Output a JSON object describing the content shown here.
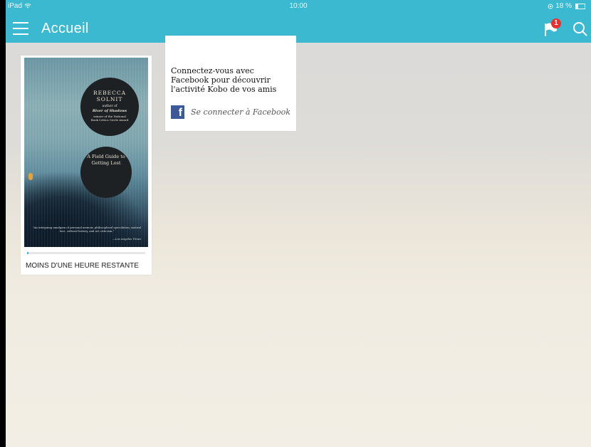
{
  "status_bar": {
    "device": "iPad",
    "time": "10:00",
    "battery": "18 %"
  },
  "nav": {
    "title": "Accueil",
    "notification_count": "1"
  },
  "book": {
    "cover_author": "REBECCA SOLNIT",
    "cover_author_of": "author of",
    "cover_previous_book": "River of Shadows",
    "cover_award": "winner of the National Book Critics Circle Award",
    "cover_title": "A Field Guide to Getting Lost",
    "cover_blurb": "\"An intriguing amalgam of personal memoir, philosophical speculation, natural lore, cultural history, and art criticism.\"",
    "cover_blurb_source": "—Los Angeles Times",
    "progress": 0.01,
    "time_remaining": "MOINS D'UNE HEURE RESTANTE"
  },
  "facebook_card": {
    "message": "Connectez-vous avec Facebook pour découvrir l'activité Kobo de vos amis",
    "link": "Se connecter à Facebook"
  },
  "colors": {
    "accent": "#3bb9d0",
    "badge": "#e8312f",
    "facebook": "#3b5998"
  },
  "icons": [
    "menu-icon",
    "flag-icon",
    "search-icon",
    "wifi-icon",
    "battery-icon",
    "facebook-icon"
  ]
}
